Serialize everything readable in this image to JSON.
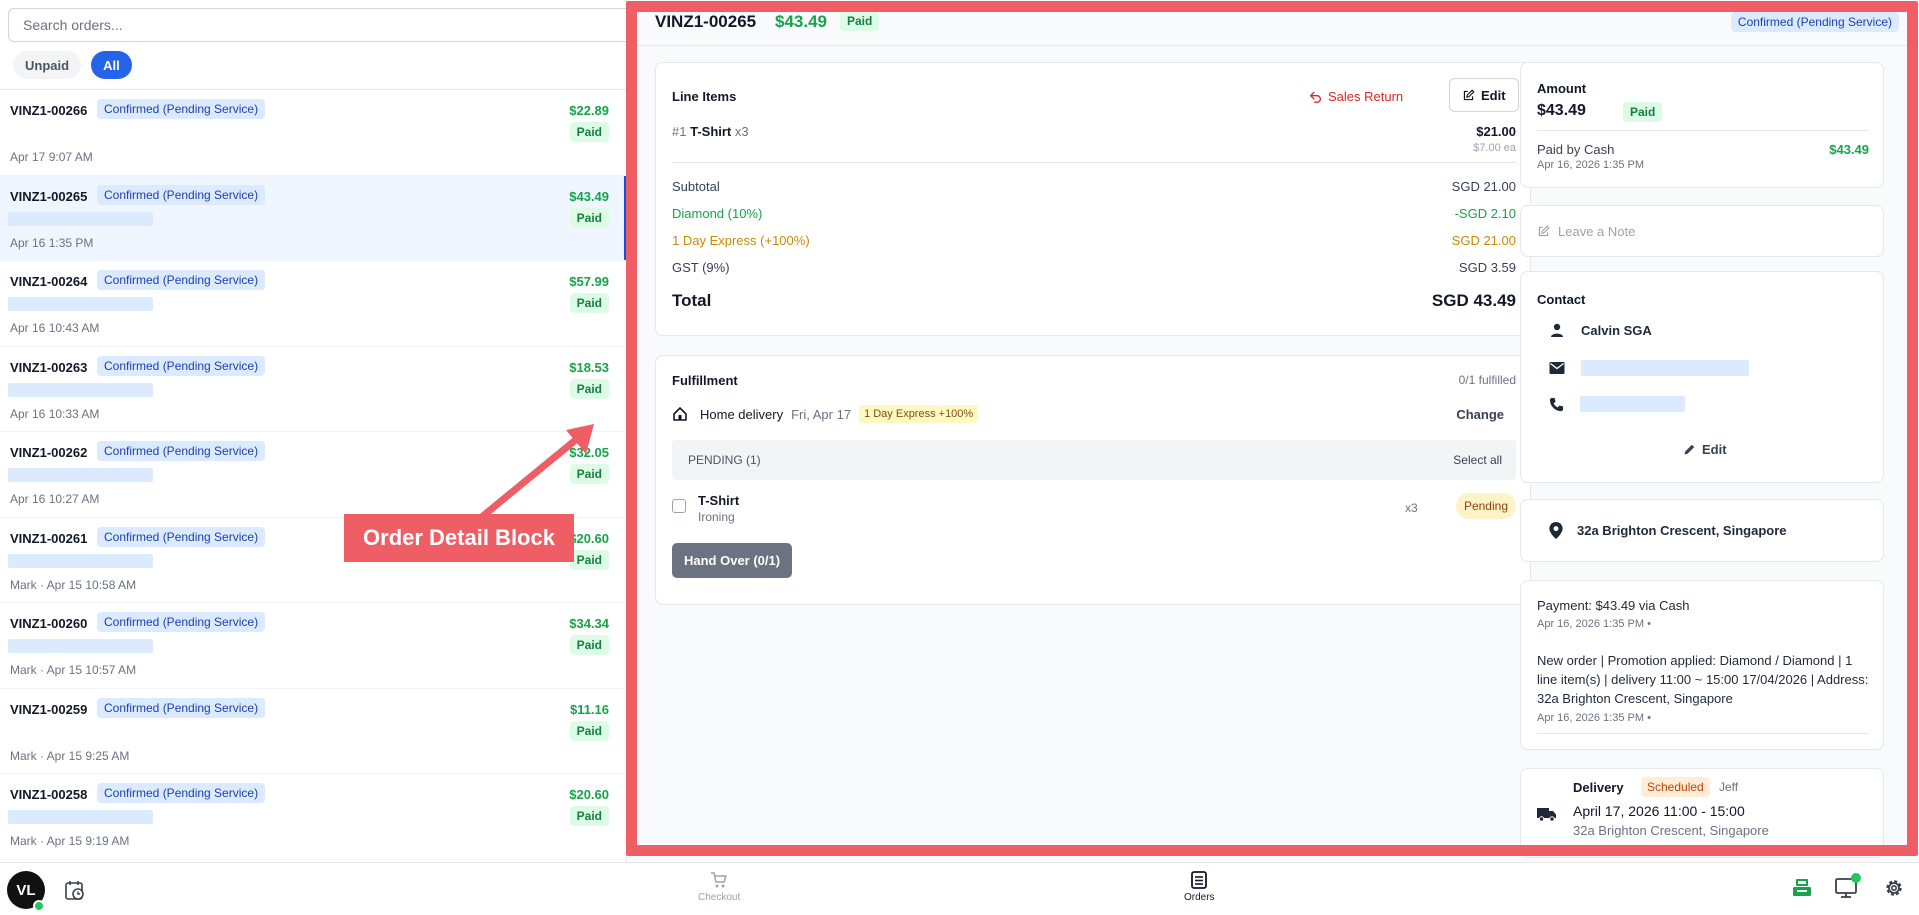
{
  "sidebar": {
    "search_placeholder": "Search orders...",
    "filters": {
      "unpaid": "Unpaid",
      "all": "All"
    },
    "orders": [
      {
        "id": "VINZ1-00266",
        "status": "Confirmed (Pending Service)",
        "amount": "$22.89",
        "paid": "Paid",
        "date": "Apr 17 9:07 AM"
      },
      {
        "id": "VINZ1-00265",
        "status": "Confirmed (Pending Service)",
        "amount": "$43.49",
        "paid": "Paid",
        "date": "Apr 16 1:35 PM"
      },
      {
        "id": "VINZ1-00264",
        "status": "Confirmed (Pending Service)",
        "amount": "$57.99",
        "paid": "Paid",
        "date": "Apr 16 10:43 AM"
      },
      {
        "id": "VINZ1-00263",
        "status": "Confirmed (Pending Service)",
        "amount": "$18.53",
        "paid": "Paid",
        "date": "Apr 16 10:33 AM"
      },
      {
        "id": "VINZ1-00262",
        "status": "Confirmed (Pending Service)",
        "amount": "$32.05",
        "paid": "Paid",
        "date": "Apr 16 10:27 AM"
      },
      {
        "id": "VINZ1-00261",
        "status": "Confirmed (Pending Service)",
        "amount": "$20.60",
        "paid": "Paid",
        "date": "Mark · Apr 15 10:58 AM"
      },
      {
        "id": "VINZ1-00260",
        "status": "Confirmed (Pending Service)",
        "amount": "$34.34",
        "paid": "Paid",
        "date": "Mark · Apr 15 10:57 AM"
      },
      {
        "id": "VINZ1-00259",
        "status": "Confirmed (Pending Service)",
        "amount": "$11.16",
        "paid": "Paid",
        "date": "Mark · Apr 15 9:25 AM"
      },
      {
        "id": "VINZ1-00258",
        "status": "Confirmed (Pending Service)",
        "amount": "$20.60",
        "paid": "Paid",
        "date": "Mark · Apr 15 9:19 AM"
      }
    ]
  },
  "detail": {
    "id": "VINZ1-00265",
    "amount": "$43.49",
    "paid": "Paid",
    "status": "Confirmed (Pending Service)",
    "line_items": {
      "title": "Line Items",
      "sales_return": "Sales Return",
      "edit": "Edit",
      "item_index": "#1",
      "item_name": "T-Shirt",
      "item_qty": "x3",
      "item_price": "$21.00",
      "item_each": "$7.00 ea",
      "subtotal_label": "Subtotal",
      "subtotal_value": "SGD 21.00",
      "discount_label": "Diamond (10%)",
      "discount_value": "-SGD 2.10",
      "express_label": "1 Day Express (+100%)",
      "express_value": "SGD 21.00",
      "gst_label": "GST (9%)",
      "gst_value": "SGD 3.59",
      "total_label": "Total",
      "total_value": "SGD 43.49"
    },
    "fulfillment": {
      "title": "Fulfillment",
      "count": "0/1 fulfilled",
      "method": "Home delivery",
      "date": "Fri, Apr 17",
      "express": "1 Day Express +100%",
      "change": "Change",
      "pending_label": "PENDING (1)",
      "select_all": "Select all",
      "item_name": "T-Shirt",
      "item_service": "Ironing",
      "item_qty": "x3",
      "item_status": "Pending",
      "handover": "Hand Over (0/1)"
    },
    "amount_card": {
      "label": "Amount",
      "value": "$43.49",
      "paid": "Paid",
      "paid_by": "Paid by Cash",
      "paid_date": "Apr 16, 2026 1:35 PM",
      "paid_amount": "$43.49"
    },
    "note": {
      "placeholder": "Leave a Note"
    },
    "contact": {
      "title": "Contact",
      "name": "Calvin SGA",
      "edit": "Edit"
    },
    "address": "32a Brighton Crescent, Singapore",
    "log": {
      "payment_text": "Payment: $43.49 via Cash",
      "payment_date": "Apr 16, 2026 1:35 PM •",
      "order_text": "New order | Promotion applied: Diamond / Diamond | 1 line item(s) | delivery 11:00 ~ 15:00 17/04/2026 | Address: 32a Brighton Crescent, Singapore",
      "order_date": "Apr 16, 2026 1:35 PM •"
    },
    "delivery": {
      "label": "Delivery",
      "status": "Scheduled",
      "driver": "Jeff",
      "time": "April 17, 2026 11:00 - 15:00",
      "address": "32a Brighton Crescent, Singapore"
    }
  },
  "annotation": {
    "label": "Order Detail Block",
    "color": "#ef5e65"
  },
  "bottom_bar": {
    "avatar_initials": "VL",
    "checkout": "Checkout",
    "orders": "Orders",
    "icons": [
      "clock-icon",
      "cart-icon",
      "orders-icon",
      "cash-register-icon",
      "monitor-icon",
      "gear-icon"
    ]
  }
}
